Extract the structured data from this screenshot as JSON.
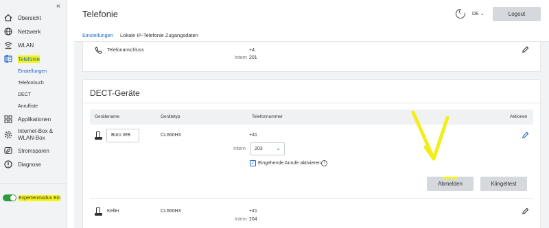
{
  "sidebar": {
    "collapse_label": "«",
    "items": [
      {
        "label": "Übersicht",
        "icon": "home-icon"
      },
      {
        "label": "Netzwerk",
        "icon": "globe-icon"
      },
      {
        "label": "WLAN",
        "icon": "wifi-icon"
      },
      {
        "label": "Telefonie",
        "icon": "telephony-icon"
      },
      {
        "label": "Applikationen",
        "icon": "apps-icon"
      },
      {
        "label": "Internet-Box & WLAN-Box",
        "icon": "gear-icon"
      },
      {
        "label": "Stromsparen",
        "icon": "leaf-icon"
      },
      {
        "label": "Diagnose",
        "icon": "alert-icon"
      }
    ],
    "subitems": [
      "Einstellungen",
      "Telefonbuch",
      "DECT",
      "Anrufliste"
    ],
    "expert_mode_label": "Expertenmodus Ein",
    "expert_mode_on": true
  },
  "header": {
    "title": "Telefonie",
    "language": "DE",
    "logout_label": "Logout"
  },
  "tabs": [
    "Einstellungen",
    "Lokale IP-Telefonie Zugangsdaten"
  ],
  "phone_connection": {
    "label": "Telefonanschluss",
    "number": "+4.",
    "intern_label": "Intern",
    "intern_value": "201"
  },
  "dect": {
    "title": "DECT-Geräte",
    "columns": [
      "Gerätename",
      "Gerätetyp",
      "Telefonnummer",
      "Aktionen"
    ],
    "devices": [
      {
        "name": "Büro WB",
        "type": "CL660HX",
        "number": "+41",
        "intern_label": "Intern",
        "intern_value": "203",
        "incoming_label": "Eingehende Anrufe aktivieren",
        "incoming_checked": true,
        "deregister_label": "Abmelden",
        "ringtest_label": "Klingeltest"
      },
      {
        "name": "Keller",
        "type": "CL660HX",
        "number": "+41",
        "intern_label": "Intern",
        "intern_value": "204"
      }
    ]
  },
  "colors": {
    "accent": "#1b66c9",
    "highlight": "#f5f51a",
    "toggle_on": "#2d9a3c"
  }
}
